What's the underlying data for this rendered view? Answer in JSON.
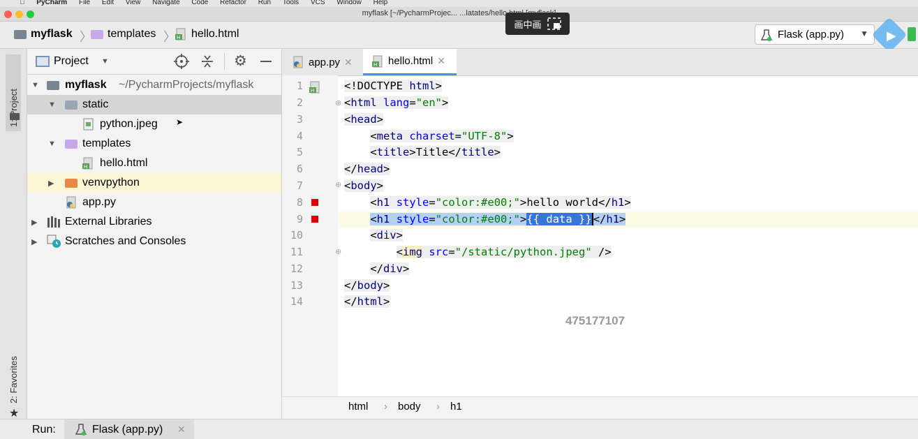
{
  "menubar": {
    "items": [
      "PyCharm",
      "File",
      "Edit",
      "View",
      "Navigate",
      "Code",
      "Refactor",
      "Run",
      "Tools",
      "VCS",
      "Window",
      "Help"
    ]
  },
  "window": {
    "title": "myflask [~/PycharmProjec... ...latates/hello.html [myflask]"
  },
  "pip": {
    "label": "画中画"
  },
  "breadcrumb": {
    "items": [
      "myflask",
      "templates",
      "hello.html"
    ]
  },
  "run_config": {
    "label": "Flask (app.py)"
  },
  "left_strip": {
    "project_tab": "1: Project",
    "favorites_tab": "2: Favorites"
  },
  "project_panel": {
    "title": "Project",
    "tree": [
      {
        "label": "myflask",
        "suffix": "~/PycharmProjects/myflask"
      },
      {
        "label": "static"
      },
      {
        "label": "python.jpeg"
      },
      {
        "label": "templates"
      },
      {
        "label": "hello.html"
      },
      {
        "label": "venvpython"
      },
      {
        "label": "app.py"
      },
      {
        "label": "External Libraries"
      },
      {
        "label": "Scratches and Consoles"
      }
    ]
  },
  "editor": {
    "tabs": [
      {
        "label": "app.py"
      },
      {
        "label": "hello.html"
      }
    ],
    "line_numbers": [
      "1",
      "2",
      "3",
      "4",
      "5",
      "6",
      "7",
      "8",
      "9",
      "10",
      "11",
      "12",
      "13",
      "14"
    ],
    "watermark": "475177107",
    "breadcrumb": [
      "html",
      "body",
      "h1"
    ]
  },
  "run_bar": {
    "label": "Run:",
    "tab": "Flask (app.py)"
  },
  "colors": {
    "accent": "#3875d7",
    "folder_blue": "#8aa4c8",
    "folder_purple": "#c9a8ea",
    "folder_orange": "#e8894a",
    "breakpoint": "#e00000"
  }
}
